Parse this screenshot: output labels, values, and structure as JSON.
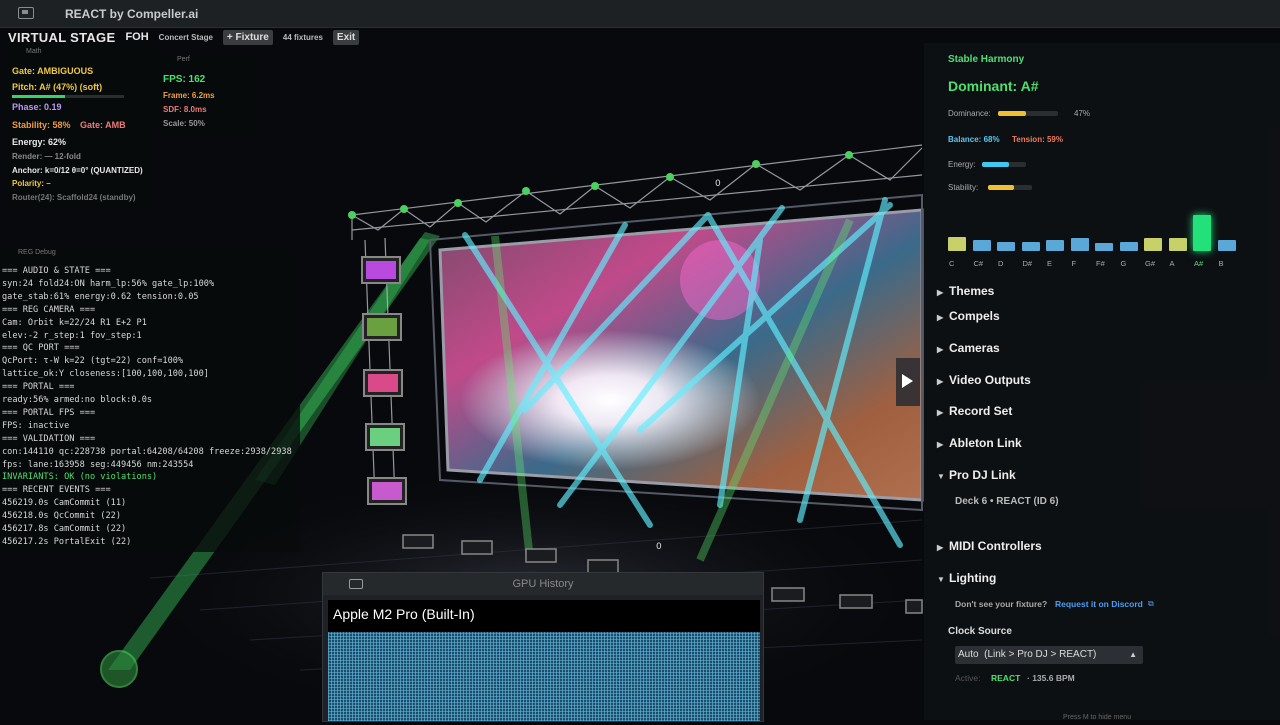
{
  "window": {
    "title": "REACT by Compeller.ai"
  },
  "toolbar": {
    "virtual_stage": "VIRTUAL STAGE",
    "view": "FOH",
    "venue": "Concert Stage",
    "add_fixture": "+ Fixture",
    "fixture_count": "44 fixtures",
    "exit": "Exit"
  },
  "math": {
    "title": "Math",
    "gate": "Gate: AMBIGUOUS",
    "pitch": "Pitch: A# (47%) (soft)",
    "pitch_level": 0.47,
    "phase": "Phase: 0.19",
    "stability": "Stability: 58%",
    "gate_short": "Gate: AMB",
    "energy": "Energy: 62%",
    "render": "Render: — 12-fold",
    "anchor": "Anchor: k=0/12 θ=0° (QUANTIZED)",
    "polarity": "Polarity: –",
    "router": "Router(24): Scaffold24 (standby)"
  },
  "perf": {
    "title": "Perf",
    "fps": "FPS: 162",
    "frame": "Frame: 6.2ms",
    "sdf": "SDF: 8.0ms",
    "scale": "Scale: 50%"
  },
  "reg_debug": {
    "title": "REG Debug",
    "lines": [
      "=== AUDIO & STATE ===",
      "syn:24 fold24:ON harm_lp:56% gate_lp:100%",
      "gate_stab:61% energy:0.62 tension:0.05",
      "=== REG CAMERA ===",
      "Cam: Orbit k=22/24 R1 E+2 P1",
      "elev:-2 r_step:1 fov_step:1",
      "=== QC PORT ===",
      "QcPort: τ-W k=22 (tgt=22) conf=100%",
      "lattice_ok:Y closeness:[100,100,100,100]",
      "=== PORTAL ===",
      "ready:56% armed:no block:0.0s",
      "=== PORTAL FPS ===",
      "FPS: inactive",
      "=== VALIDATION ===",
      "con:144110 qc:228738 portal:64208/64208 freeze:2938/2938",
      "fps: lane:163958 seg:449456 nm:243554",
      "INVARIANTS: OK (no violations)",
      "=== RECENT EVENTS ===",
      "456219.0s CamCommit (11)",
      "456218.0s QcCommit (22)",
      "456217.8s CamCommit (22)",
      "456217.2s PortalExit (22)"
    ]
  },
  "harmony": {
    "title": "Stable Harmony",
    "dominant": "Dominant: A#",
    "dominance_label": "Dominance:",
    "dominance_value": "47%",
    "dominance_level": 0.47,
    "balance": "Balance: 68%",
    "tension": "Tension: 59%",
    "energy_label": "Energy:",
    "energy_level": 0.62,
    "stability_label": "Stability:",
    "stability_level": 0.58,
    "notes": [
      "C",
      "C#",
      "D",
      "D#",
      "E",
      "F",
      "F#",
      "G",
      "G#",
      "A",
      "A#",
      "B"
    ],
    "note_levels": [
      0.4,
      0.3,
      0.25,
      0.25,
      0.3,
      0.35,
      0.22,
      0.25,
      0.35,
      0.35,
      1.0,
      0.3
    ],
    "note_colors": [
      "#c8d06a",
      "#5aa8d8",
      "#5aa8d8",
      "#5aa8d8",
      "#5aa8d8",
      "#5aa8d8",
      "#5aa8d8",
      "#5aa8d8",
      "#c8d06a",
      "#c8d06a",
      "#22e07a",
      "#5aa8d8"
    ]
  },
  "sections": {
    "themes": "Themes",
    "compels": "Compels",
    "cameras": "Cameras",
    "video_outputs": "Video Outputs",
    "record_set": "Record Set",
    "ableton_link": "Ableton Link",
    "pro_dj_link": "Pro DJ Link",
    "deck": "Deck 6 • REACT (ID 6)",
    "midi": "MIDI Controllers",
    "lighting": "Lighting"
  },
  "lighting": {
    "fixture_question": "Don't see your fixture?",
    "discord_link": "Request it on Discord",
    "clock_source_label": "Clock Source",
    "clock_source_value": "Auto  (Link > Pro DJ > REACT)",
    "active_label": "Active:",
    "active_value": "REACT",
    "bpm": "· 135.6 BPM"
  },
  "footer_hint": "Press M to hide menu",
  "gpu": {
    "title": "GPU History",
    "device": "Apple M2 Pro (Built-In)"
  },
  "truss_labels": {
    "top": "0",
    "bottom": "0"
  }
}
